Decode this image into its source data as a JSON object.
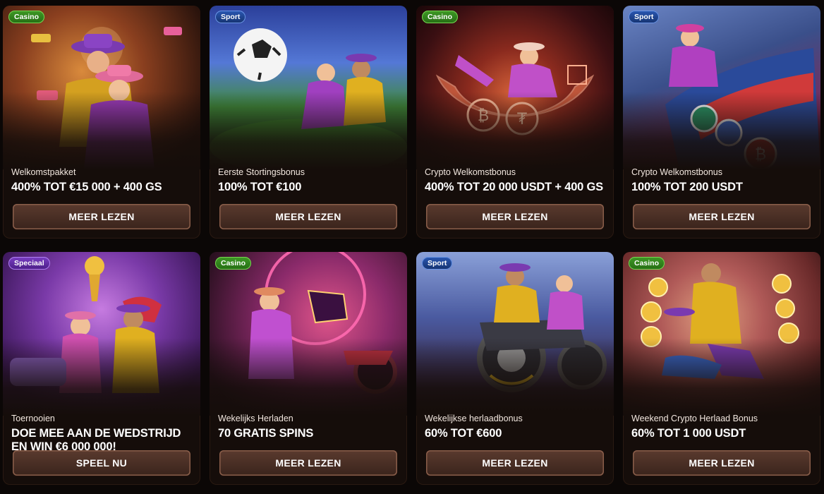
{
  "cards": [
    {
      "badge": "Casino",
      "subtitle": "Welkomstpakket",
      "title": "400% TOT €15 000 + 400 GS",
      "button": "MEER LEZEN"
    },
    {
      "badge": "Sport",
      "subtitle": "Eerste Stortingsbonus",
      "title": "100% TOT €100",
      "button": "MEER LEZEN"
    },
    {
      "badge": "Casino",
      "subtitle": "Crypto Welkomstbonus",
      "title": "400% TOT 20 000 USDT + 400 GS",
      "button": "MEER LEZEN"
    },
    {
      "badge": "Sport",
      "subtitle": "Crypto Welkomstbonus",
      "title": "100% TOT 200 USDT",
      "button": "MEER LEZEN"
    },
    {
      "badge": "Speciaal",
      "subtitle": "Toernooien",
      "title": "DOE MEE AAN DE WEDSTRIJD EN WIN €6 000 000!",
      "button": "SPEEL NU"
    },
    {
      "badge": "Casino",
      "subtitle": "Wekelijks Herladen",
      "title": "70 GRATIS SPINS",
      "button": "MEER LEZEN"
    },
    {
      "badge": "Sport",
      "subtitle": "Wekelijkse herlaadbonus",
      "title": "60% TOT €600",
      "button": "MEER LEZEN"
    },
    {
      "badge": "Casino",
      "subtitle": "Weekend Crypto Herlaad Bonus",
      "title": "60% TOT 1 000 USDT",
      "button": "MEER LEZEN"
    }
  ],
  "colors": {
    "casino_badge": "#3f9a26",
    "sport_badge": "#2a58b3",
    "special_badge": "#7b3fc4",
    "button": "#4a2f24",
    "background": "#0b0706"
  }
}
